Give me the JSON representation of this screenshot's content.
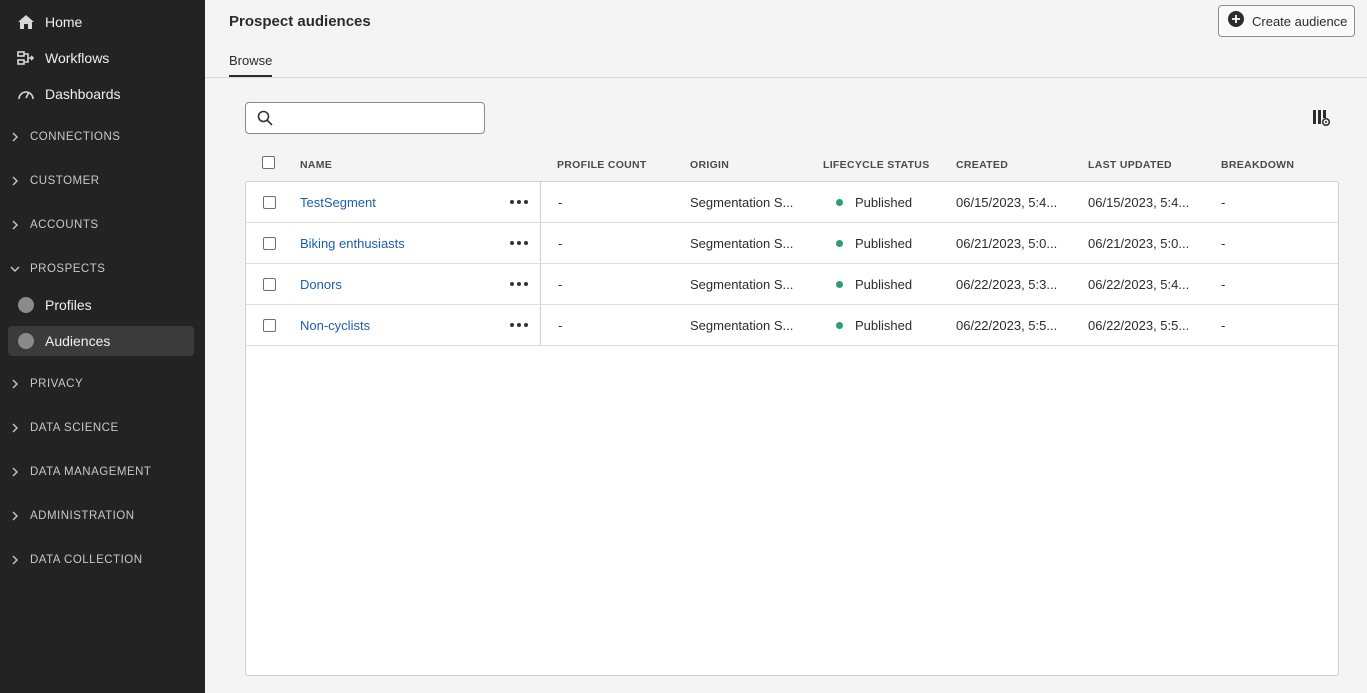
{
  "sidebar": {
    "top_items": [
      {
        "label": "Home",
        "icon": "home-icon"
      },
      {
        "label": "Workflows",
        "icon": "workflow-icon"
      },
      {
        "label": "Dashboards",
        "icon": "dashboard-icon"
      }
    ],
    "sections": {
      "connections": "CONNECTIONS",
      "customer": "CUSTOMER",
      "accounts": "ACCOUNTS",
      "prospects": "PROSPECTS",
      "privacy": "PRIVACY",
      "data_science": "DATA SCIENCE",
      "data_management": "DATA MANAGEMENT",
      "administration": "ADMINISTRATION",
      "data_collection": "DATA COLLECTION"
    },
    "prospects_items": [
      {
        "label": "Profiles",
        "selected": false
      },
      {
        "label": "Audiences",
        "selected": true
      }
    ]
  },
  "header": {
    "title": "Prospect audiences",
    "create_button": "Create audience",
    "tab": "Browse"
  },
  "search": {
    "value": ""
  },
  "table": {
    "columns": [
      "NAME",
      "PROFILE COUNT",
      "ORIGIN",
      "LIFECYCLE STATUS",
      "CREATED",
      "LAST UPDATED",
      "BREAKDOWN"
    ],
    "rows": [
      {
        "name": "TestSegment",
        "profile_count": "-",
        "origin": "Segmentation S...",
        "status": "Published",
        "created": "06/15/2023, 5:4...",
        "last_updated": "06/15/2023, 5:4...",
        "breakdown": "-"
      },
      {
        "name": "Biking enthusiasts",
        "profile_count": "-",
        "origin": "Segmentation S...",
        "status": "Published",
        "created": "06/21/2023, 5:0...",
        "last_updated": "06/21/2023, 5:0...",
        "breakdown": "-"
      },
      {
        "name": "Donors",
        "profile_count": "-",
        "origin": "Segmentation S...",
        "status": "Published",
        "created": "06/22/2023, 5:3...",
        "last_updated": "06/22/2023, 5:4...",
        "breakdown": "-"
      },
      {
        "name": "Non-cyclists",
        "profile_count": "-",
        "origin": "Segmentation S...",
        "status": "Published",
        "created": "06/22/2023, 5:5...",
        "last_updated": "06/22/2023, 5:5...",
        "breakdown": "-"
      }
    ]
  },
  "colors": {
    "sidebar_bg": "#232323",
    "link": "#1a5fb4",
    "published": "#2d9d78"
  }
}
